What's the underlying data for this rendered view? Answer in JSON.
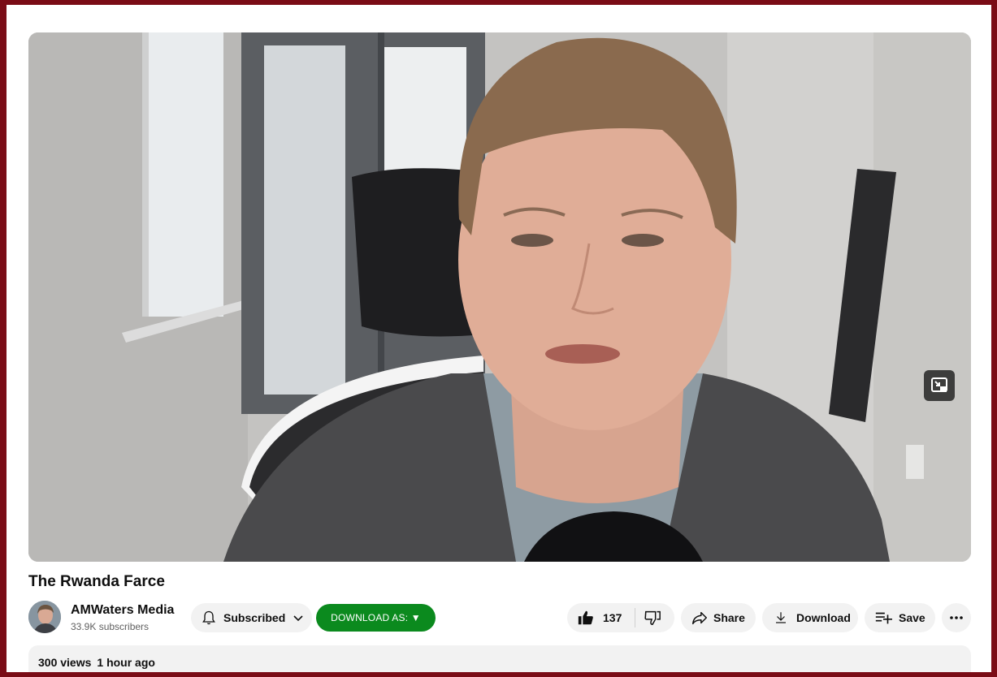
{
  "video": {
    "title": "The Rwanda Farce",
    "miniplayer_icon": "miniplayer-icon"
  },
  "channel": {
    "name": "AMWaters Media",
    "subscribers": "33.9K subscribers",
    "subscribe_label": "Subscribed"
  },
  "toolbar": {
    "download_as_label": "DOWNLOAD AS: ▼",
    "like_count": "137",
    "share_label": "Share",
    "download_label": "Download",
    "save_label": "Save"
  },
  "description": {
    "views": "300 views",
    "posted": "1 hour ago"
  },
  "colors": {
    "frame": "#7a0c16",
    "download_as_bg": "#0b8a1e",
    "pill_bg": "#f2f2f2"
  }
}
